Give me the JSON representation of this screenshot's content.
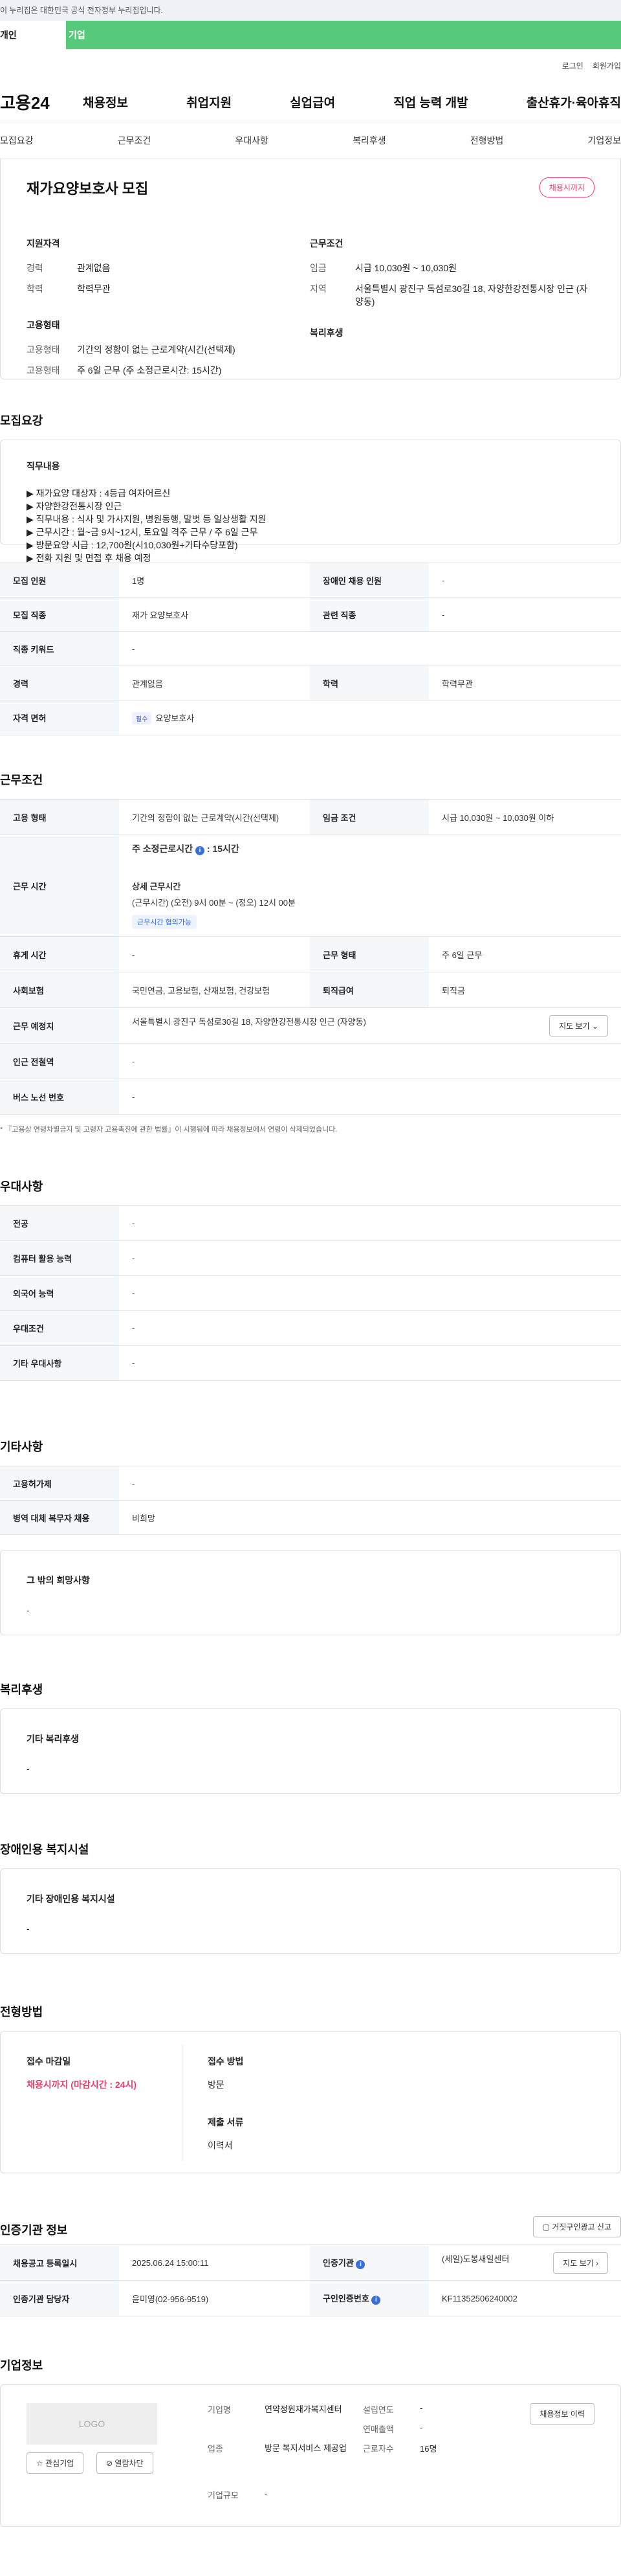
{
  "top_notice": "이 누리집은 대한민국 공식 전자정부 누리집입니다.",
  "user_tabs": {
    "person": "개인",
    "company": "기업"
  },
  "util": {
    "login": "로그인",
    "join": "회원가입"
  },
  "logo": "고용24",
  "gnb": [
    "채용정보",
    "취업지원",
    "실업급여",
    "직업 능력 개발",
    "출산휴가·육아휴직"
  ],
  "subtabs": [
    "모집요강",
    "근무조건",
    "우대사항",
    "복리후생",
    "전형방법",
    "기업정보"
  ],
  "summary": {
    "title": "재가요양보호사 모집",
    "badge": "채용시까지",
    "qual_h": "지원자격",
    "exp_k": "경력",
    "exp_v": "관계없음",
    "edu_k": "학력",
    "edu_v": "학력무관",
    "emp_h": "고용형태",
    "emp1_k": "고용형태",
    "emp1_v": "기간의 정함이 없는 근로계약(시간(선택제)",
    "emp2_k": "고용형태",
    "emp2_v": "주 6일 근무 (주 소정근로시간: 15시간)",
    "cond_h": "근무조건",
    "wage_k": "임금",
    "wage_v": "시급 10,030원 ~ 10,030원",
    "area_k": "지역",
    "area_v": "서울특별시 광진구 독섬로30길 18, 자양한강전통시장 인근 (자양동)",
    "welfare_h": "복리후생"
  },
  "recruit": {
    "title": "모집요강",
    "desc_h": "직무내용",
    "desc_lines": [
      "▶ 재가요양 대상자 : 4등급 여자어르신",
      "▶ 자양한강전통시장 인근",
      "▶ 직무내용 : 식사 및 가사지원, 병원동행, 말벗 등 일상생활 지원",
      "▶ 근무시간 : 월~금 9시~12시, 토요일 격주 근무 / 주 6일 근무",
      "▶ 방문요양 시급 : 12,700원(시10,030원+기타수당포함)",
      "▶ 전화 지원 및 면접 후 채용 예정"
    ],
    "rows": {
      "count_k": "모집 인원",
      "count_v": "1명",
      "dis_k": "장애인 채용 인원",
      "dis_v": "-",
      "job_k": "모집 직종",
      "job_v": "재가 요양보호사",
      "rel_k": "관련 직종",
      "rel_v": "-",
      "kw_k": "직종 키워드",
      "kw_v": "-",
      "exp_k": "경력",
      "exp_v": "관계없음",
      "edu_k": "학력",
      "edu_v": "학력무관",
      "lic_k": "자격 면허",
      "lic_tag": "필수",
      "lic_v": "요양보호사"
    }
  },
  "work": {
    "title": "근무조건",
    "type_k": "고용 형태",
    "type_v": "기간의 정함이 없는 근로계약(시간(선택제)",
    "wage_k": "임금 조건",
    "wage_v": "시급 10,030원 ~ 10,030원 이하",
    "time_k": "근무 시간",
    "time_main": "주 소정근로시간",
    "time_hours": ": 15시간",
    "time_sub_h": "상세 근무시간",
    "time_sub": "(근무시간) (오전) 9시 00분 ~ (정오) 12시 00분",
    "time_tag": "근무시간 협의가능",
    "rest_k": "휴게 시간",
    "rest_v": "-",
    "form_k": "근무 형태",
    "form_v": "주 6일 근무",
    "ins_k": "사회보험",
    "ins_v": "국민연금, 고용보험, 산재보험, 건강보험",
    "ret_k": "퇴직급여",
    "ret_v": "퇴직금",
    "place_k": "근무 예정지",
    "place_v": "서울특별시 광진구 독섬로30길 18, 자양한강전통시장 인근 (자양동)",
    "map_btn": "지도 보기",
    "subway_k": "인근 전철역",
    "subway_v": "-",
    "bus_k": "버스 노선 번호",
    "bus_v": "-",
    "note": "* 『고용상 연령차별금지 및 고령자 고용촉진에 관한 법률』이 시행됨에 따라 채용정보에서 연령이 삭제되었습니다."
  },
  "pref": {
    "title": "우대사항",
    "rows": [
      {
        "k": "전공",
        "v": "-"
      },
      {
        "k": "컴퓨터 활용 능력",
        "v": "-"
      },
      {
        "k": "외국어 능력",
        "v": "-"
      },
      {
        "k": "우대조건",
        "v": "-"
      },
      {
        "k": "기타 우대사항",
        "v": "-"
      }
    ]
  },
  "etc": {
    "title": "기타사항",
    "rows": [
      {
        "k": "고용허가제",
        "v": "-"
      },
      {
        "k": "병역 대체 복무자 채용",
        "v": "비희망"
      }
    ],
    "hope_h": "그 밖의 희망사항",
    "hope_v": "-"
  },
  "welfare": {
    "title": "복리후생",
    "box_h": "기타 복리후생",
    "box_v": "-"
  },
  "disfac": {
    "title": "장애인용 복지시설",
    "box_h": "기타 장애인용 복지시설",
    "box_v": "-"
  },
  "process": {
    "title": "전형방법",
    "deadline_h": "접수 마감일",
    "deadline_v": "채용시까지 (마감시간 : 24시)",
    "method_h": "접수 방법",
    "method_v": "방문",
    "docs_h": "제출 서류",
    "docs_v": "이력서"
  },
  "agency": {
    "title": "인증기관 정보",
    "report_btn": "거짓구인광고 신고",
    "reg_k": "채용공고 등록일시",
    "reg_v": "2025.06.24 15:00:11",
    "org_k": "인증기관",
    "org_v": "(세일)도봉새일센터",
    "map_btn": "지도 보기",
    "mgr_k": "인증기관 담당자",
    "mgr_v": "윤미영(02-956-9519)",
    "no_k": "구인인증번호",
    "no_v": "KF11352506240002"
  },
  "company": {
    "title": "기업정보",
    "logo": "LOGO",
    "btn_interest": "관심기업",
    "btn_block": "열람차단",
    "btn_jobs": "채용정보 이력",
    "name_k": "기업명",
    "name_v": "연약정원재가복지센터",
    "type_k": "업종",
    "type_v": "방문 복지서비스 제공업",
    "size_k": "기업규모",
    "size_v": "-",
    "est_k": "설립연도",
    "est_v": "-",
    "sales_k": "연매출액",
    "sales_v": "-",
    "emp_k": "근로자수",
    "emp_v": "16명"
  }
}
